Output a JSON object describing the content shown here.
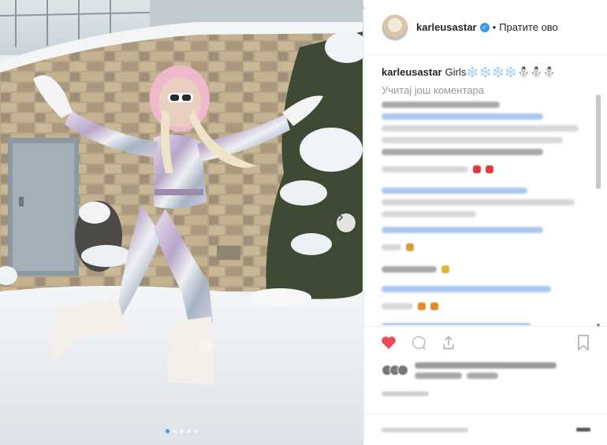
{
  "post": {
    "username": "karleusastar",
    "follow_label": "Пратите ово",
    "separator": "•",
    "caption_text": "Girls❄️❄️❄️❄️⛄⛄⛄",
    "load_more_label": "Учитај још коментара"
  },
  "carousel": {
    "slide_count": 5,
    "active_index": 0
  },
  "icons": {
    "verified": "verified-badge-icon",
    "next": "chevron-right-icon",
    "like": "heart-icon",
    "comment": "comment-icon",
    "share": "share-icon",
    "save": "bookmark-icon"
  },
  "colors": {
    "accent": "#3897f0",
    "like": "#ed4956",
    "text": "#262626",
    "muted": "#999999"
  }
}
